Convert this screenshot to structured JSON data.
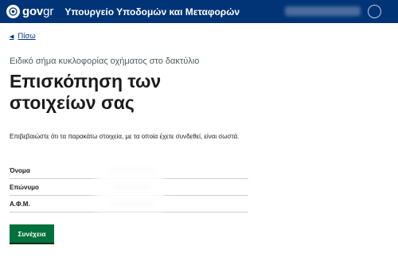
{
  "header": {
    "logo_gov": "gov",
    "logo_gr": "gr",
    "ministry": "Υπουργείο Υποδομών και Μεταφορών",
    "emblem_icon": "greek-emblem-icon",
    "user_icon": "user-icon"
  },
  "nav": {
    "back_label": "Πίσω",
    "back_icon": "chevron-left-icon"
  },
  "page": {
    "caption": "Ειδικό σήμα κυκλοφορίας οχήματος στο δακτύλιο",
    "title": "Επισκόπηση των στοιχείων σας",
    "intro": "Επιβεβαιώστε ότι τα παρακάτω στοιχεία, με τα οποία έχετε συνδεθεί, είναι σωστά."
  },
  "summary": {
    "rows": [
      {
        "label": "Όνομα"
      },
      {
        "label": "Επώνυμο"
      },
      {
        "label": "Α.Φ.Μ."
      }
    ]
  },
  "actions": {
    "continue_label": "Συνέχεια"
  },
  "colors": {
    "header_bg": "#003476",
    "primary_button": "#00703c",
    "link": "#003476"
  }
}
